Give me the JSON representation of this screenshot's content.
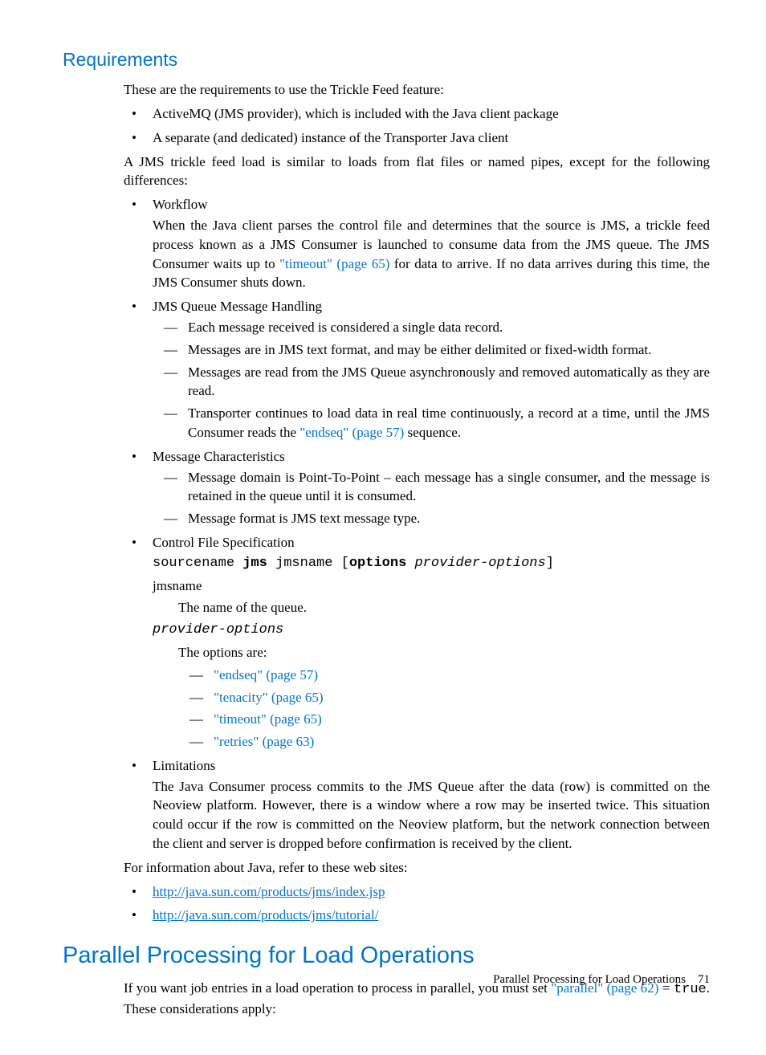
{
  "h_requirements": "Requirements",
  "intro": "These are the requirements to use the Trickle Feed feature:",
  "req1": "ActiveMQ (JMS provider), which is included with the Java client package",
  "req2": "A separate (and dedicated) instance of the Transporter Java client",
  "jms_intro": "A JMS trickle feed load is similar to loads from flat files or named pipes, except for the following differences:",
  "b_workflow": "Workflow",
  "workflow_p1a": "When the Java client parses the control file and determines that the source is JMS, a trickle feed process known as a JMS Consumer is launched to consume data from the JMS queue. The JMS Consumer waits up to ",
  "workflow_link": "\"timeout\" (page 65)",
  "workflow_p1b": " for data to arrive. If no data arrives during this time, the JMS Consumer shuts down.",
  "b_jms_handling": "JMS Queue Message Handling",
  "jms_d1": "Each message received is considered a single data record.",
  "jms_d2": "Messages are in JMS text format, and may be either delimited or fixed-width format.",
  "jms_d3": "Messages are read from the JMS Queue asynchronously and removed automatically as they are read.",
  "jms_d4a": "Transporter continues to load data in real time continuously, a record at a time, until the JMS Consumer reads the ",
  "jms_d4_link": "\"endseq\" (page 57)",
  "jms_d4b": " sequence.",
  "b_msgchar": "Message Characteristics",
  "mc_d1": "Message domain is Point-To-Point – each message has a single consumer, and the message is retained in the queue until it is consumed.",
  "mc_d2": "Message format is JMS text message type.",
  "b_cfs": "Control File Specification",
  "cfs_code_sourcename": "sourcename ",
  "cfs_code_jms": "jms",
  "cfs_code_jmsname": " jmsname [",
  "cfs_code_options": "options",
  "cfs_code_sp": " ",
  "cfs_code_provopt": "provider-options",
  "cfs_code_close": "]",
  "cfs_jmsname_term": "jmsname",
  "cfs_jmsname_def": "The name of the queue.",
  "cfs_provopt_term": "provider-options",
  "cfs_provopt_def": "The options are:",
  "opt_endseq": "\"endseq\" (page 57)",
  "opt_tenacity": "\"tenacity\" (page 65)",
  "opt_timeout": "\"timeout\" (page 65)",
  "opt_retries": "\"retries\" (page 63)",
  "b_limit": "Limitations",
  "limit_p": "The Java Consumer process commits to the JMS Queue after the data (row) is committed on the Neoview platform. However, there is a window where a row may be inserted twice. This situation could occur if the row is committed on the Neoview platform, but the network connection between the client and server is dropped before confirmation is received by the client.",
  "java_sites": "For information about Java, refer to these web sites:",
  "url1": "http://java.sun.com/products/jms/index.jsp",
  "url2": "http://java.sun.com/products/jms/tutorial/",
  "h_parallel": "Parallel Processing for Load Operations",
  "parallel_p1a": "If you want job entries in a load operation to process in parallel, you must set ",
  "parallel_link": "\"parallel\" (page 62)",
  "parallel_p1b": " = ",
  "parallel_true": "true",
  "parallel_p1c": ". These considerations apply:",
  "footer_text": "Parallel Processing for Load Operations",
  "footer_page": "71"
}
